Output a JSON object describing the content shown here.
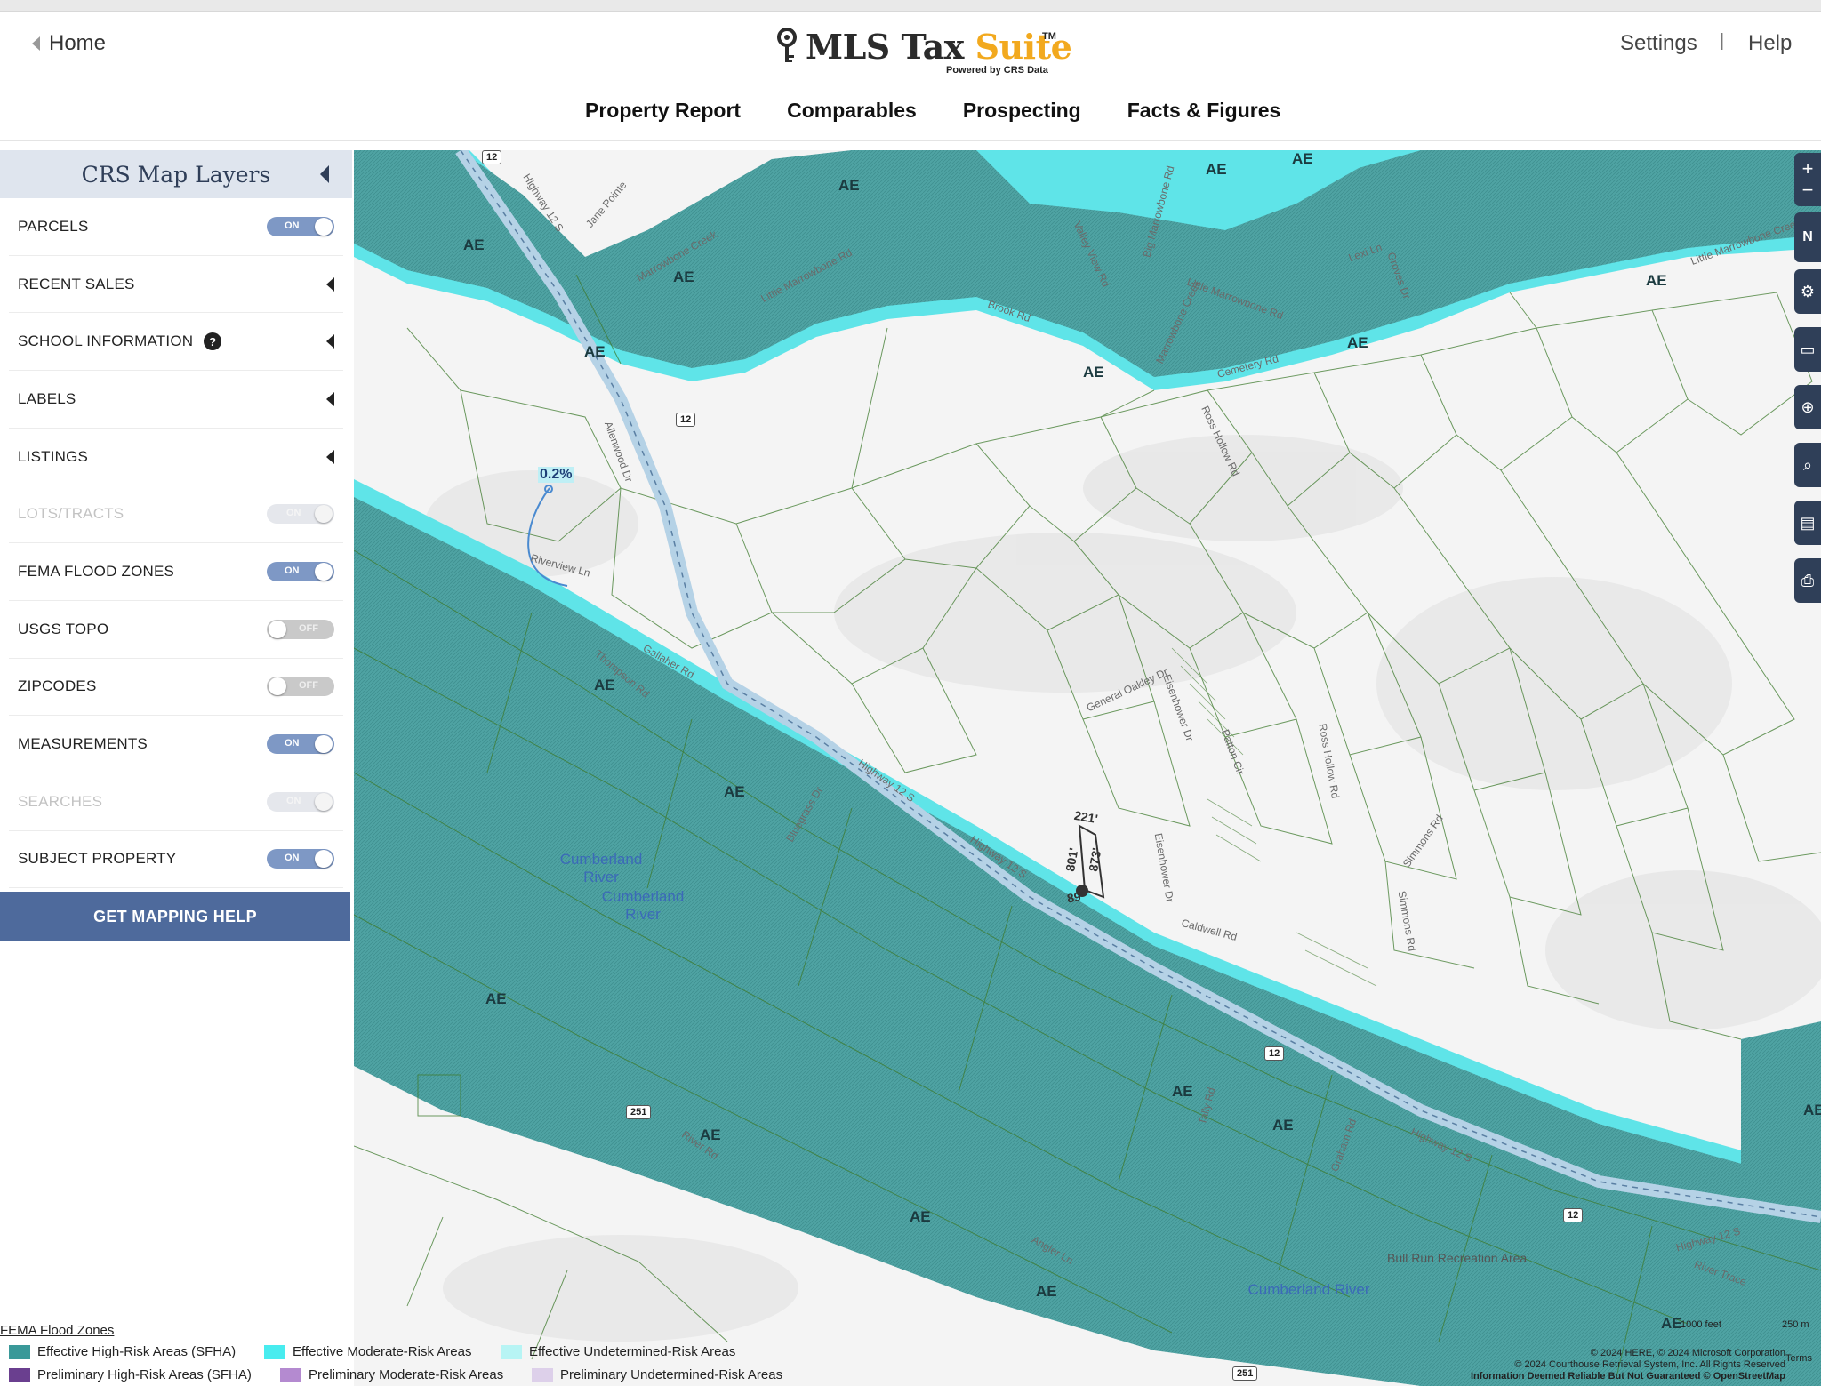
{
  "header": {
    "home_label": "Home",
    "logo_main": "MLS Tax ",
    "logo_accent": "Suite",
    "logo_tm": "TM",
    "logo_sub": "Powered by CRS Data",
    "settings_label": "Settings",
    "separator": "|",
    "help_label": "Help"
  },
  "nav": {
    "tabs": [
      "Property Report",
      "Comparables",
      "Prospecting",
      "Facts & Figures"
    ]
  },
  "sidebar": {
    "title": "CRS Map Layers",
    "rows": [
      {
        "label": "PARCELS",
        "control": "toggle",
        "state": "ON"
      },
      {
        "label": "RECENT SALES",
        "control": "chevron"
      },
      {
        "label": "SCHOOL INFORMATION",
        "control": "chevron",
        "help": "?"
      },
      {
        "label": "LABELS",
        "control": "chevron"
      },
      {
        "label": "LISTINGS",
        "control": "chevron"
      },
      {
        "label": "LOTS/TRACTS",
        "control": "toggle",
        "state": "ON",
        "disabled": true
      },
      {
        "label": "FEMA FLOOD ZONES",
        "control": "toggle",
        "state": "ON"
      },
      {
        "label": "USGS TOPO",
        "control": "toggle",
        "state": "OFF"
      },
      {
        "label": "ZIPCODES",
        "control": "toggle",
        "state": "OFF"
      },
      {
        "label": "MEASUREMENTS",
        "control": "toggle",
        "state": "ON"
      },
      {
        "label": "SEARCHES",
        "control": "toggle",
        "state": "ON",
        "disabled": true
      },
      {
        "label": "SUBJECT PROPERTY",
        "control": "toggle",
        "state": "ON"
      }
    ],
    "help_button": "GET MAPPING HELP"
  },
  "map": {
    "flood_zone_labels": [
      "AE",
      "AE",
      "AE",
      "AE",
      "AE",
      "AE",
      "AE",
      "AE",
      "AE",
      "AE",
      "AE",
      "AE",
      "AE",
      "AE",
      "AE",
      "AE",
      "AE",
      "AE",
      "AE",
      "AE",
      "AE",
      "AE"
    ],
    "percent_label": "0.2%",
    "river_labels": [
      "Cumberland River",
      "Cumberland River",
      "Cumberland River"
    ],
    "area_labels": [
      "Bull Run Recreation Area"
    ],
    "streets": [
      "Highway 12 S",
      "Jane Pointe",
      "Marrowbone Creek",
      "Little Marrowbone Rd",
      "Valley View Rd",
      "Big Marrowbone Rd",
      "Lexi Ln",
      "Groves Dr",
      "Little Marrowbone Creek",
      "Little Marrowbone Rd",
      "Brook Rd",
      "Marrowbone Creek",
      "Cemetery Rd",
      "Ross Hollow Rd",
      "Allenwood Dr",
      "Riverview Ln",
      "Thompson Rd",
      "Gallaher Rd",
      "Highway 12 S",
      "Highway 12 S",
      "Bluegrass Dr",
      "General Oakley Dr",
      "Eisenhower Dr",
      "Patton Cir",
      "Ross Hollow Rd",
      "Simmons Rd",
      "Eisenhower Dr",
      "Caldwell Rd",
      "Simmons Rd",
      "Tally Rd",
      "Graham Rd",
      "Highway 12 S",
      "Highway 12 S",
      "River Rd",
      "Angler Ln",
      "River Trace"
    ],
    "route_shields": [
      "12",
      "12",
      "12",
      "12",
      "251",
      "251"
    ],
    "measurements": [
      "221'",
      "801'",
      "873'",
      "89'"
    ],
    "controls": [
      "+",
      "−",
      "N",
      "⚙",
      "▭",
      "⊕",
      "⌕",
      "▤",
      "⎙"
    ],
    "scale_labels": [
      "1000 feet",
      "250 m"
    ],
    "attribution": [
      "© 2024 HERE, © 2024 Microsoft Corporation",
      "© 2024 Courthouse Retrieval System, Inc. All Rights Reserved",
      "Information Deemed Reliable But Not Guaranteed © OpenStreetMap"
    ],
    "terms": "Terms"
  },
  "legend": {
    "title": "FEMA Flood Zones",
    "items": [
      {
        "label": "Effective High-Risk Areas (SFHA)",
        "color": "#3a9999"
      },
      {
        "label": "Effective Moderate-Risk Areas",
        "color": "#48ecef"
      },
      {
        "label": "Effective Undetermined-Risk Areas",
        "color": "#b7f4f4"
      },
      {
        "label": "Preliminary High-Risk Areas (SFHA)",
        "color": "#6a3f8f"
      },
      {
        "label": "Preliminary Moderate-Risk Areas",
        "color": "#b48ad0"
      },
      {
        "label": "Preliminary Undetermined-Risk Areas",
        "color": "#ddd0ea"
      }
    ]
  },
  "colors": {
    "flood_high": "#4fa8a8",
    "flood_moderate": "#5fe6ea",
    "parcel_line": "#3d7a2c",
    "sidebar_header": "#dfe5ee",
    "button": "#4e6a9c"
  }
}
